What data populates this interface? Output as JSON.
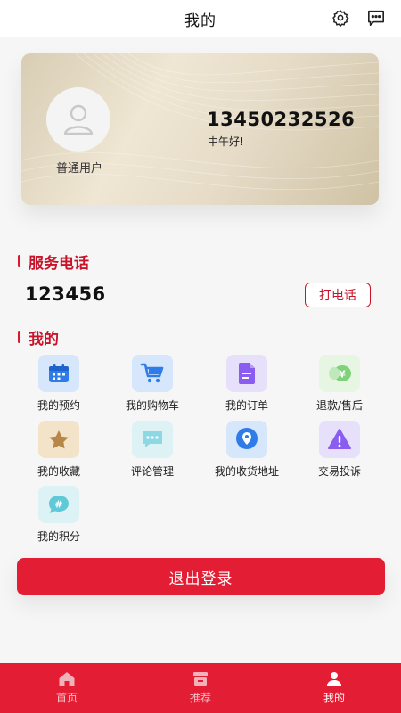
{
  "header": {
    "title": "我的",
    "icons": [
      "gear-icon",
      "chat-icon"
    ]
  },
  "profile": {
    "user_type": "普通用户",
    "phone": "13450232526",
    "greeting": "中午好!"
  },
  "service": {
    "title": "服务电话",
    "number": "123456",
    "call_label": "打电话"
  },
  "mine": {
    "title": "我的",
    "items": [
      {
        "label": "我的预约",
        "icon": "calendar-icon"
      },
      {
        "label": "我的购物车",
        "icon": "cart-icon"
      },
      {
        "label": "我的订单",
        "icon": "document-icon"
      },
      {
        "label": "退款/售后",
        "icon": "refund-icon"
      },
      {
        "label": "我的收藏",
        "icon": "star-icon"
      },
      {
        "label": "评论管理",
        "icon": "comment-icon"
      },
      {
        "label": "我的收货地址",
        "icon": "location-icon"
      },
      {
        "label": "交易投诉",
        "icon": "warning-icon"
      },
      {
        "label": "我的积分",
        "icon": "points-icon"
      }
    ]
  },
  "logout_label": "退出登录",
  "tabs": [
    {
      "label": "首页",
      "icon": "home-icon",
      "active": false
    },
    {
      "label": "推荐",
      "icon": "store-icon",
      "active": false
    },
    {
      "label": "我的",
      "icon": "user-icon",
      "active": true
    }
  ],
  "colors": {
    "accent": "#e31d33",
    "section_title": "#c8142a",
    "card_gold": "#e6dcc8"
  }
}
